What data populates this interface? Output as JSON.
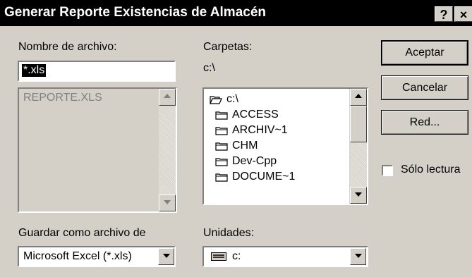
{
  "window": {
    "title": "Generar Reporte Existencias de Almacén",
    "help_label": "?",
    "close_label": "×"
  },
  "file_name": {
    "label": "Nombre de archivo:",
    "value": "*.xls",
    "files": [
      "REPORTE.XLS"
    ]
  },
  "folders": {
    "label": "Carpetas:",
    "current_path": "c:\\",
    "items": [
      {
        "name": "c:\\",
        "icon": "open-folder-icon"
      },
      {
        "name": "ACCESS",
        "icon": "folder-icon"
      },
      {
        "name": "ARCHIV~1",
        "icon": "folder-icon"
      },
      {
        "name": "CHM",
        "icon": "folder-icon"
      },
      {
        "name": "Dev-Cpp",
        "icon": "folder-icon"
      },
      {
        "name": "DOCUME~1",
        "icon": "folder-icon"
      }
    ]
  },
  "buttons": {
    "accept": "Aceptar",
    "cancel": "Cancelar",
    "network": "Red..."
  },
  "read_only": {
    "label": "Sólo lectura",
    "checked": false
  },
  "save_as": {
    "label": "Guardar como archivo de",
    "selected": "Microsoft Excel (*.xls)"
  },
  "drives": {
    "label": "Unidades:",
    "selected": "c:",
    "icon": "drive-icon"
  }
}
